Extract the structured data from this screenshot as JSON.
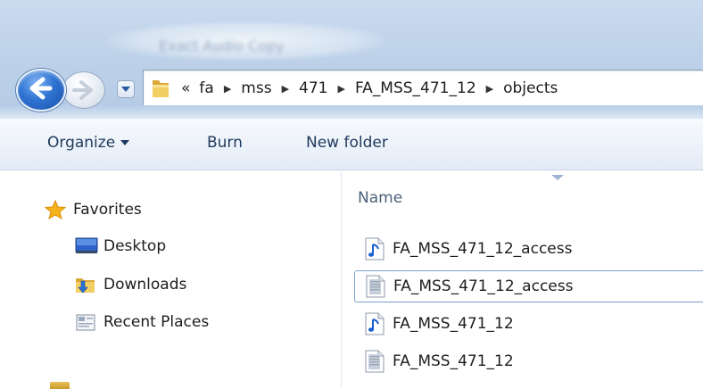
{
  "window": {
    "title": "Exact Audio Copy"
  },
  "address_bar": {
    "overflow": "«",
    "crumbs": [
      "fa",
      "mss",
      "471",
      "FA_MSS_471_12",
      "objects"
    ]
  },
  "toolbar": {
    "organize_label": "Organize",
    "burn_label": "Burn",
    "new_folder_label": "New folder"
  },
  "nav_pane": {
    "favorites_label": "Favorites",
    "items": [
      {
        "label": "Desktop",
        "icon": "desktop-icon"
      },
      {
        "label": "Downloads",
        "icon": "downloads-folder-icon"
      },
      {
        "label": "Recent Places",
        "icon": "recent-places-icon"
      }
    ]
  },
  "file_list": {
    "column_name": "Name",
    "files": [
      {
        "name": "FA_MSS_471_12_access",
        "icon": "audio-file-icon",
        "selected": false
      },
      {
        "name": "FA_MSS_471_12_access",
        "icon": "text-file-icon",
        "selected": true
      },
      {
        "name": "FA_MSS_471_12",
        "icon": "audio-file-icon",
        "selected": false
      },
      {
        "name": "FA_MSS_471_12",
        "icon": "text-file-icon",
        "selected": false
      }
    ]
  },
  "colors": {
    "accent": "#2f74d3",
    "toolbar_text": "#1e395b",
    "selection_border": "#7da2ce"
  }
}
